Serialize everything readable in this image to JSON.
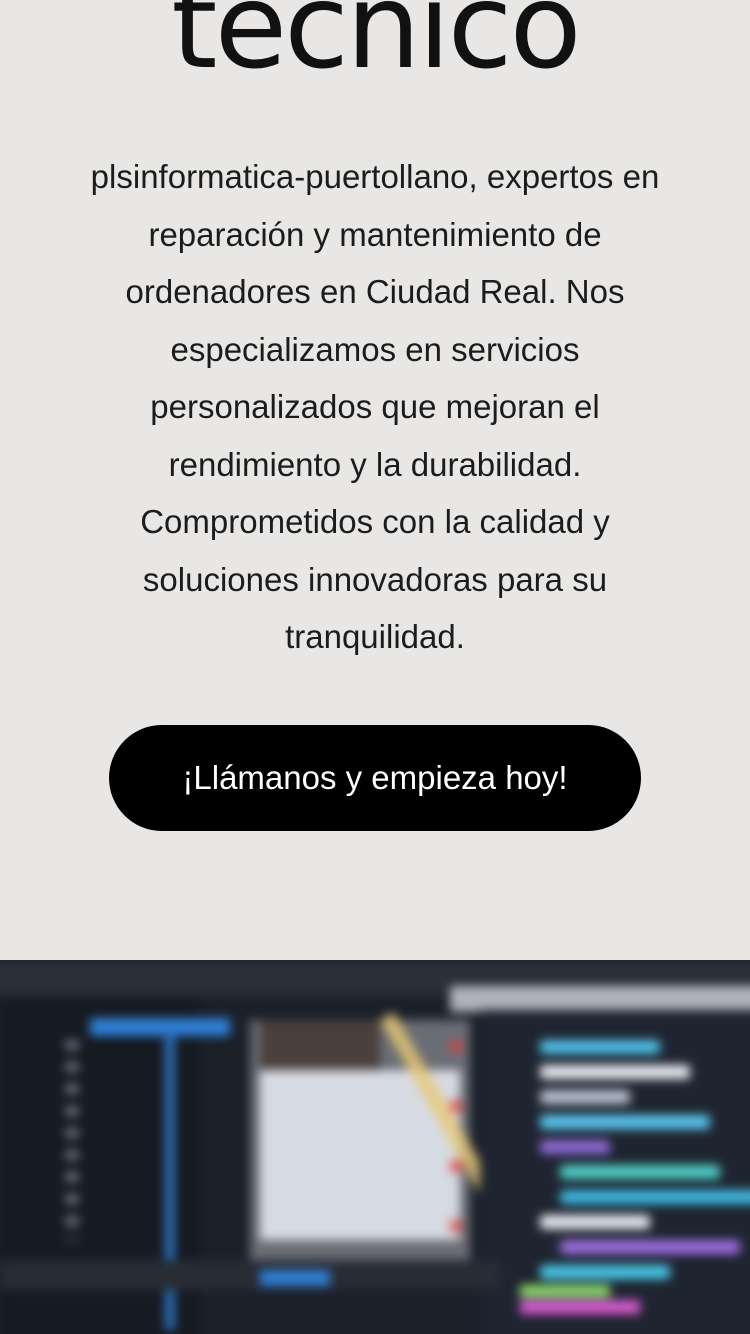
{
  "hero": {
    "heading": "técnico",
    "description": "plsinformatica-puertollano, expertos en reparación y mantenimiento de ordenadores en Ciudad Real. Nos especializamos en servicios personalizados que mejoran el rendimiento y la durabilidad. Comprometidos con la calidad y soluciones innovadoras para su tranquilidad.",
    "cta_label": "¡Llámanos y empieza hoy!"
  },
  "colors": {
    "background": "#e8e7e5",
    "button": "#000000",
    "button_text": "#ffffff",
    "text": "#1c1c1c"
  }
}
